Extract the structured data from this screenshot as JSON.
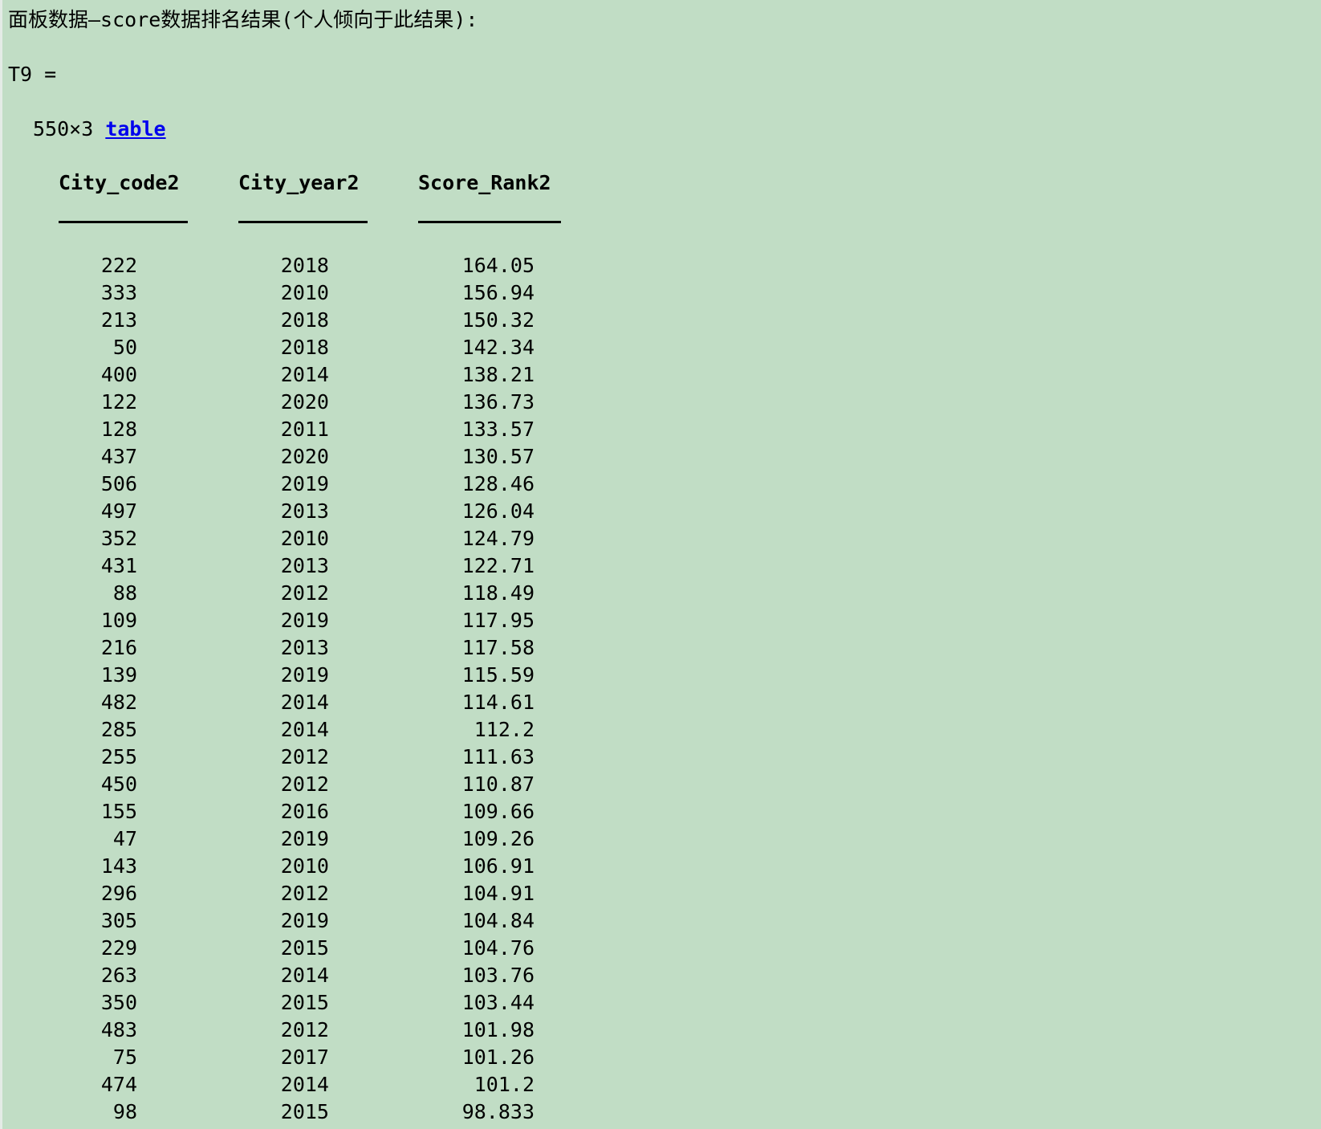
{
  "heading": "面板数据—score数据排名结果(个人倾向于此结果):",
  "variable_line": "T9 =",
  "size_text": "550×3 ",
  "size_link": "table",
  "columns": [
    "City_code2",
    "City_year2",
    "Score_Rank2"
  ],
  "rows": [
    [
      "222",
      "2018",
      "164.05"
    ],
    [
      "333",
      "2010",
      "156.94"
    ],
    [
      "213",
      "2018",
      "150.32"
    ],
    [
      "50",
      "2018",
      "142.34"
    ],
    [
      "400",
      "2014",
      "138.21"
    ],
    [
      "122",
      "2020",
      "136.73"
    ],
    [
      "128",
      "2011",
      "133.57"
    ],
    [
      "437",
      "2020",
      "130.57"
    ],
    [
      "506",
      "2019",
      "128.46"
    ],
    [
      "497",
      "2013",
      "126.04"
    ],
    [
      "352",
      "2010",
      "124.79"
    ],
    [
      "431",
      "2013",
      "122.71"
    ],
    [
      "88",
      "2012",
      "118.49"
    ],
    [
      "109",
      "2019",
      "117.95"
    ],
    [
      "216",
      "2013",
      "117.58"
    ],
    [
      "139",
      "2019",
      "115.59"
    ],
    [
      "482",
      "2014",
      "114.61"
    ],
    [
      "285",
      "2014",
      "112.2"
    ],
    [
      "255",
      "2012",
      "111.63"
    ],
    [
      "450",
      "2012",
      "110.87"
    ],
    [
      "155",
      "2016",
      "109.66"
    ],
    [
      "47",
      "2019",
      "109.26"
    ],
    [
      "143",
      "2010",
      "106.91"
    ],
    [
      "296",
      "2012",
      "104.91"
    ],
    [
      "305",
      "2019",
      "104.84"
    ],
    [
      "229",
      "2015",
      "104.76"
    ],
    [
      "263",
      "2014",
      "103.76"
    ],
    [
      "350",
      "2015",
      "103.44"
    ],
    [
      "483",
      "2012",
      "101.98"
    ],
    [
      "75",
      "2017",
      "101.26"
    ],
    [
      "474",
      "2014",
      "101.2"
    ],
    [
      "98",
      "2015",
      "98.833"
    ]
  ]
}
